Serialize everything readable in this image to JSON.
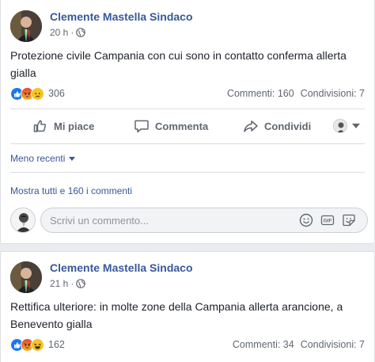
{
  "posts": [
    {
      "author": "Clemente Mastella Sindaco",
      "time": "20 h",
      "separator": "·",
      "text": "Protezione civile Campania con cui sono in contatto conferma allerta gialla",
      "reaction_count": "306",
      "comments": "Commenti: 160",
      "shares": "Condivisioni: 7",
      "reactions": [
        "like",
        "angry",
        "sad"
      ]
    },
    {
      "author": "Clemente Mastella Sindaco",
      "time": "21 h",
      "separator": "·",
      "text": "Rettifica ulteriore: in molte zone della Campania allerta arancione, a Benevento gialla",
      "reaction_count": "162",
      "comments": "Commenti: 34",
      "shares": "Condivisioni: 7",
      "reactions": [
        "like",
        "angry",
        "haha"
      ]
    }
  ],
  "actions": {
    "like": "Mi piace",
    "comment": "Commenta",
    "share": "Condividi"
  },
  "sort_label": "Meno recenti",
  "show_all": "Mostra tutti e 160 i commenti",
  "comment_placeholder": "Scrivi un commento...",
  "icons": [
    "globe-icon",
    "like-icon",
    "comment-icon",
    "share-icon",
    "emoji-icon",
    "gif-icon",
    "sticker-icon"
  ],
  "colors": {
    "link": "#385898",
    "like_blue": "#1877f2",
    "angry": "#e9710f",
    "sad": "#f7b125",
    "background": "#e9ebee"
  }
}
